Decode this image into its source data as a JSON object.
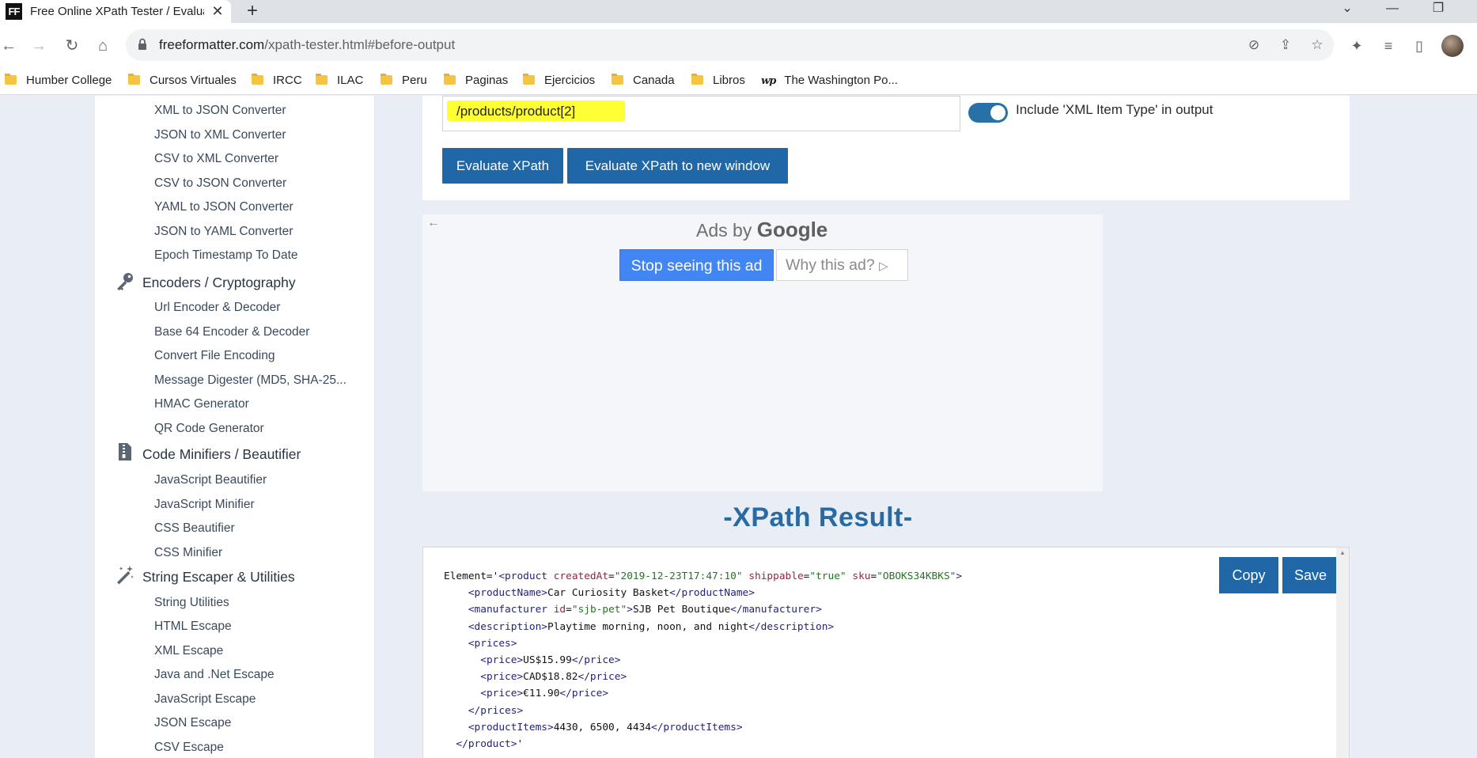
{
  "browser": {
    "tab_title": "Free Online XPath Tester / Evaluator",
    "favicon_text": "FF",
    "url_domain": "freeformatter.com",
    "url_path": "/xpath-tester.html#before-output",
    "bookmarks": [
      "Humber College",
      "Cursos Virtuales",
      "IRCC",
      "ILAC",
      "Peru",
      "Paginas",
      "Ejercicios",
      "Canada",
      "Libros",
      "The Washington Po..."
    ]
  },
  "sidebar": {
    "links_top": [
      "XML to JSON Converter",
      "JSON to XML Converter",
      "CSV to XML Converter",
      "CSV to JSON Converter",
      "YAML to JSON Converter",
      "JSON to YAML Converter",
      "Epoch Timestamp To Date"
    ],
    "categories": [
      {
        "label": "Encoders / Cryptography",
        "icon": "key-icon",
        "links": [
          "Url Encoder & Decoder",
          "Base 64 Encoder & Decoder",
          "Convert File Encoding",
          "Message Digester (MD5, SHA-25...",
          "HMAC Generator",
          "QR Code Generator"
        ]
      },
      {
        "label": "Code Minifiers / Beautifier",
        "icon": "zip-file-icon",
        "links": [
          "JavaScript Beautifier",
          "JavaScript Minifier",
          "CSS Beautifier",
          "CSS Minifier"
        ]
      },
      {
        "label": "String Escaper & Utilities",
        "icon": "magic-wand-icon",
        "links": [
          "String Utilities",
          "HTML Escape",
          "XML Escape",
          "Java and .Net Escape",
          "JavaScript Escape",
          "JSON Escape",
          "CSV Escape"
        ]
      }
    ]
  },
  "main": {
    "xpath_expression": "/products/product[2]",
    "toggle_label": "Include 'XML Item Type' in output",
    "toggle_on": true,
    "evaluate_button": "Evaluate XPath",
    "evaluate_new_window_button": "Evaluate XPath to new window",
    "accent_color": "#1f67a6",
    "highlight_color": "#ffff35"
  },
  "ad": {
    "ads_by": "Ads by",
    "google": "Google",
    "stop_seeing": "Stop seeing this ad",
    "why_this_ad": "Why this ad?"
  },
  "result": {
    "title": "-XPath Result-",
    "copy_button": "Copy",
    "save_button": "Save",
    "element_prefix": "Element='",
    "product": {
      "createdAt": "2019-12-23T17:47:10",
      "shippable": "true",
      "sku": "OBOKS34KBKS",
      "productName": "Car Curiosity Basket",
      "manufacturer_id": "sjb-pet",
      "manufacturer": "SJB Pet Boutique",
      "description": "Playtime morning, noon, and night",
      "prices": [
        "US$15.99",
        "CAD$18.82",
        "€11.90"
      ],
      "productItems": "4430, 6500, 4434"
    }
  }
}
